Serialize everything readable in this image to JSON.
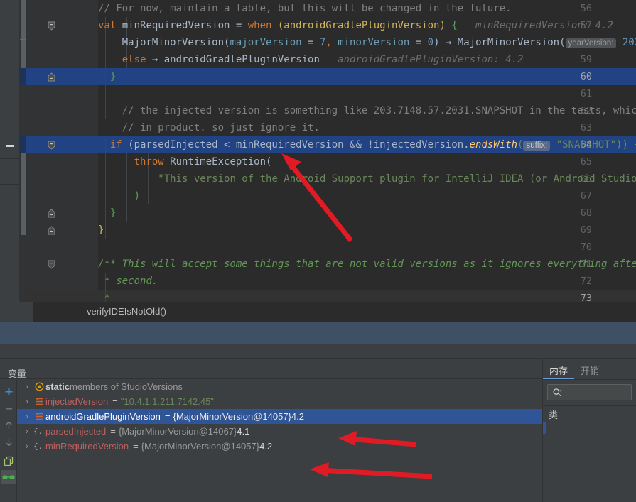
{
  "editor": {
    "lines": [
      {
        "num": "56",
        "fold": "",
        "state": "normal"
      },
      {
        "num": "57",
        "fold": "collapse-start",
        "state": "normal"
      },
      {
        "num": "58",
        "fold": "",
        "state": "normal"
      },
      {
        "num": "59",
        "fold": "",
        "state": "normal"
      },
      {
        "num": "60",
        "fold": "collapse-end",
        "state": "selected"
      },
      {
        "num": "61",
        "fold": "",
        "state": "normal"
      },
      {
        "num": "62",
        "fold": "",
        "state": "normal"
      },
      {
        "num": "63",
        "fold": "",
        "state": "normal"
      },
      {
        "num": "64",
        "fold": "collapse-start",
        "state": "selected"
      },
      {
        "num": "65",
        "fold": "",
        "state": "normal"
      },
      {
        "num": "66",
        "fold": "",
        "state": "normal"
      },
      {
        "num": "67",
        "fold": "",
        "state": "normal"
      },
      {
        "num": "68",
        "fold": "collapse-end",
        "state": "normal"
      },
      {
        "num": "69",
        "fold": "collapse-end",
        "state": "normal"
      },
      {
        "num": "70",
        "fold": "",
        "state": "normal"
      },
      {
        "num": "71",
        "fold": "collapse-start",
        "state": "normal"
      },
      {
        "num": "72",
        "fold": "",
        "state": "normal"
      },
      {
        "num": "73",
        "fold": "",
        "state": "current"
      }
    ],
    "code": {
      "l56_comment": "// For now, maintain a table, but this will be changed in the future.",
      "l57_kw_val": "val",
      "l57_name": " minRequiredVersion = ",
      "l57_kw_when": "when",
      "l57_paren": " (androidGradlePluginVersion)",
      "l57_brace": " {",
      "l57_hint": "minRequiredVersion: 4.2",
      "l58_type": "MajorMinorVersion(",
      "l58_p1": "majorVersion",
      "l58_eq1": " = ",
      "l58_v1": "7",
      "l58_comma": ", ",
      "l58_p2": "minorVersion",
      "l58_eq2": " = ",
      "l58_v2": "0",
      "l58_arrow": ") → MajorMinorVersion(",
      "l58_chip": "yearVersion:",
      "l58_year": " 202",
      "l59_kw_else": "else",
      "l59_body": " → androidGradlePluginVersion",
      "l59_hint": "androidGradlePluginVersion: 4.2",
      "l62_comment": "// the injected version is something like 203.7148.57.2031.SNAPSHOT in the tests, which is no",
      "l63_comment": "// in product. so just ignore it.",
      "l64_kw_if": "if",
      "l64_cond": " (parsedInjected < minRequiredVersion && !injectedVersion.",
      "l64_fn": "endsWith",
      "l64_paren": "(",
      "l64_chip": "suffix:",
      "l64_str": "\"SNAPSHOT\"",
      "l64_close": "))",
      "l64_brace": " {",
      "l64_tail": "i",
      "l65_kw_throw": "throw",
      "l65_rest": " RuntimeException(",
      "l66_str": "\"This version of the Android Support plugin for IntelliJ IDEA (or Android Studio) can",
      "l67_close": ")",
      "l68_brace": "}",
      "l69_brace": "}",
      "l71_doc": "/** This will accept some things that are not valid versions as it ignores everything after the",
      "l72_doc": "* second.",
      "l73_doc": "*"
    }
  },
  "frame": {
    "method": "verifyIDEIsNotOld()"
  },
  "debug": {
    "variables_title": "变量",
    "toolbar": [
      {
        "name": "add-watch-button",
        "glyph": "+"
      },
      {
        "name": "remove-watch-button",
        "glyph": "−"
      },
      {
        "name": "move-up-button",
        "glyph": "↑"
      },
      {
        "name": "move-down-button",
        "glyph": "↓"
      },
      {
        "name": "copy-button",
        "glyph": "⧉"
      },
      {
        "name": "inspect-button",
        "glyph": "◑"
      }
    ],
    "rows": [
      {
        "arrow": "›",
        "icon": "static-members-icon",
        "prefix": "static",
        "suffix": " members of StudioVersions",
        "eq": "",
        "ref": "",
        "value": "",
        "str": "",
        "selected": false,
        "kind": "static"
      },
      {
        "arrow": "›",
        "icon": "field-icon",
        "name": "injectedVersion",
        "eq": "=",
        "str": "\"10.4.1.1.211.7142.45\"",
        "ref": "",
        "value": "",
        "selected": false,
        "kind": "field"
      },
      {
        "arrow": "›",
        "icon": "field-icon",
        "name": "androidGradlePluginVersion",
        "eq": "=",
        "ref": "{MajorMinorVersion@14057}",
        "value": "4.2",
        "str": "",
        "selected": true,
        "kind": "field"
      },
      {
        "arrow": "›",
        "icon": "object-icon",
        "name": "parsedInjected",
        "eq": "=",
        "ref": "{MajorMinorVersion@14067}",
        "value": "4.1",
        "str": "",
        "selected": false,
        "kind": "object"
      },
      {
        "arrow": "›",
        "icon": "object-icon",
        "name": "minRequiredVersion",
        "eq": "=",
        "ref": "{MajorMinorVersion@14057}",
        "value": "4.2",
        "str": "",
        "selected": false,
        "kind": "object"
      }
    ]
  },
  "memory": {
    "tabs": [
      {
        "label": "内存",
        "active": true
      },
      {
        "label": "开销",
        "active": false
      }
    ],
    "search_placeholder": "",
    "class_header": "类"
  },
  "colors": {
    "editor_bg": "#2b2b2b",
    "gutter_bg": "#313335",
    "selection_blue": "#214283",
    "panel_bg": "#3c3f41",
    "row_selected": "#2f5597",
    "accent_tab": "#6b9bd2",
    "annotation_arrow": "#e01b24",
    "string_green": "#6a8759",
    "keyword_orange": "#cc7832",
    "doc_green": "#629755",
    "var_name_red": "#bf5f5f"
  }
}
